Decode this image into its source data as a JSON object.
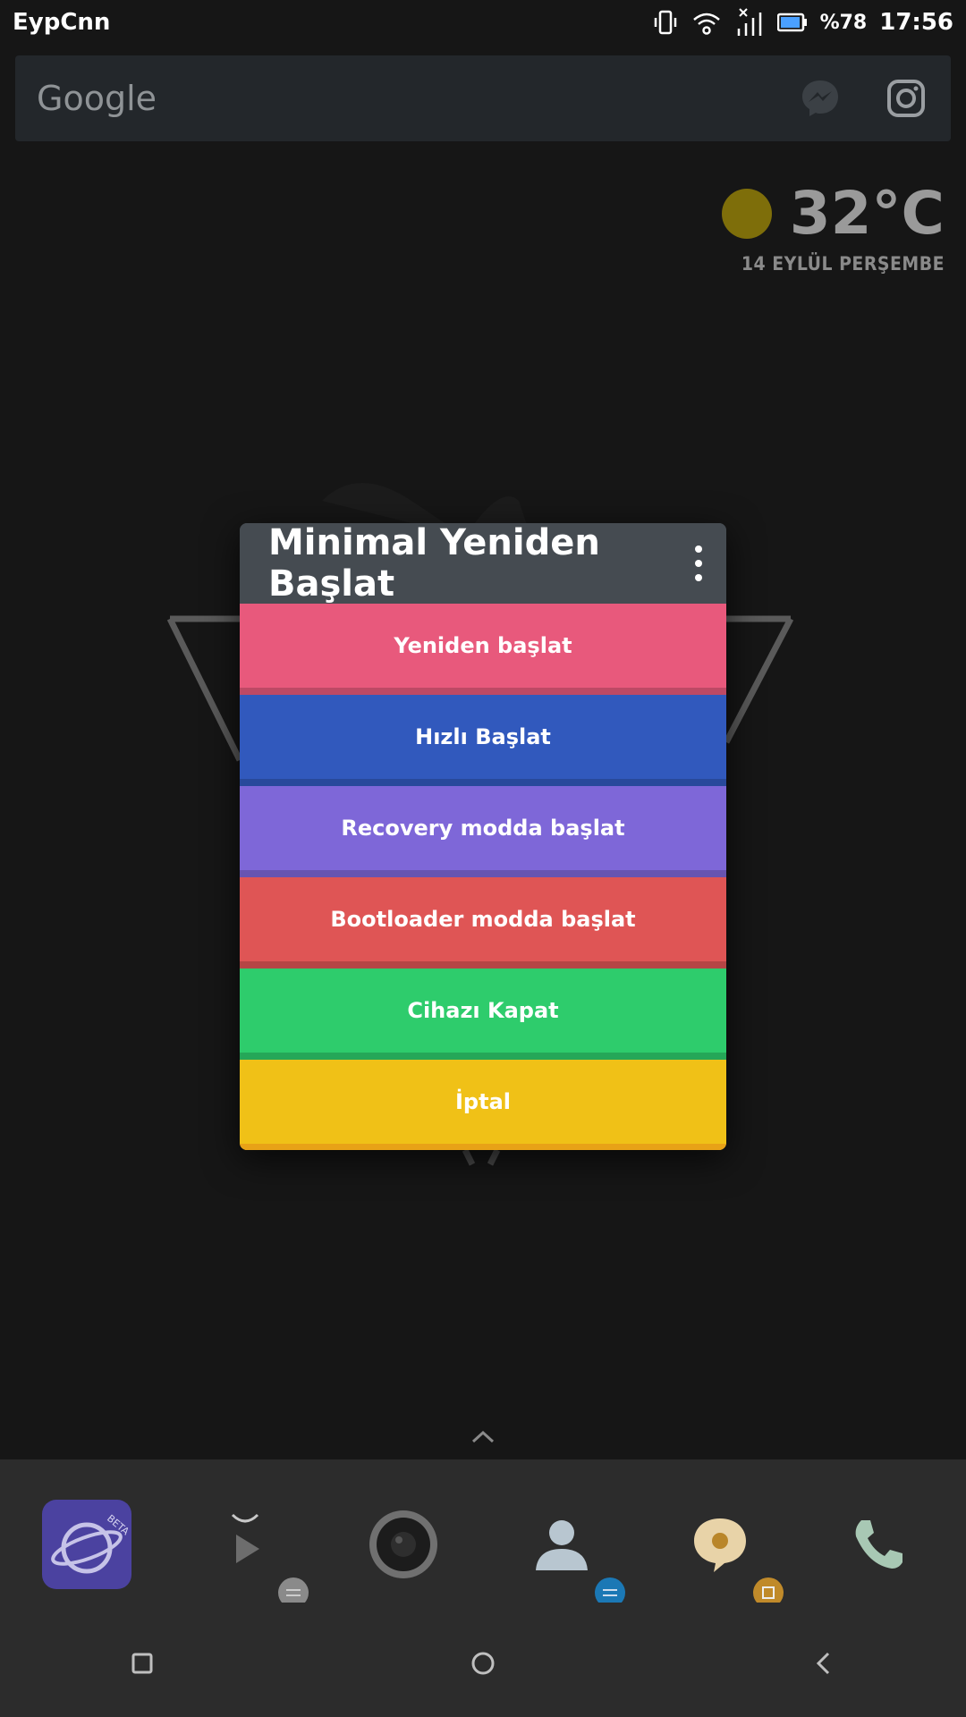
{
  "status_bar": {
    "carrier": "EypCnn",
    "battery_percent": "%78",
    "time": "17:56"
  },
  "search_bar": {
    "logo_text": "Google",
    "icons": [
      "messenger-icon",
      "instagram-icon"
    ]
  },
  "weather": {
    "temperature": "32°C",
    "date": "14 EYLÜL PERŞEMBE",
    "icon": "sun-icon"
  },
  "dialog": {
    "title": "Minimal Yeniden Başlat",
    "options": [
      {
        "label": "Yeniden başlat",
        "color": "#e8597c"
      },
      {
        "label": "Hızlı Başlat",
        "color": "#3159bd"
      },
      {
        "label": "Recovery modda başlat",
        "color": "#7e67d8"
      },
      {
        "label": "Bootloader modda başlat",
        "color": "#df5555"
      },
      {
        "label": "Cihazı Kapat",
        "color": "#2ecc6c"
      },
      {
        "label": "İptal",
        "color": "#f0c117"
      }
    ]
  },
  "dock": {
    "apps": [
      {
        "name": "internet-beta",
        "badge_text": "BETA",
        "color": "#5a4fa8"
      },
      {
        "name": "play-store",
        "color": "#9a9a9a"
      },
      {
        "name": "camera",
        "color": "#8c8c8c"
      },
      {
        "name": "contacts",
        "color": "#1f5d82"
      },
      {
        "name": "messages",
        "color": "#b9862a"
      },
      {
        "name": "phone",
        "color": "#11683b"
      }
    ]
  }
}
